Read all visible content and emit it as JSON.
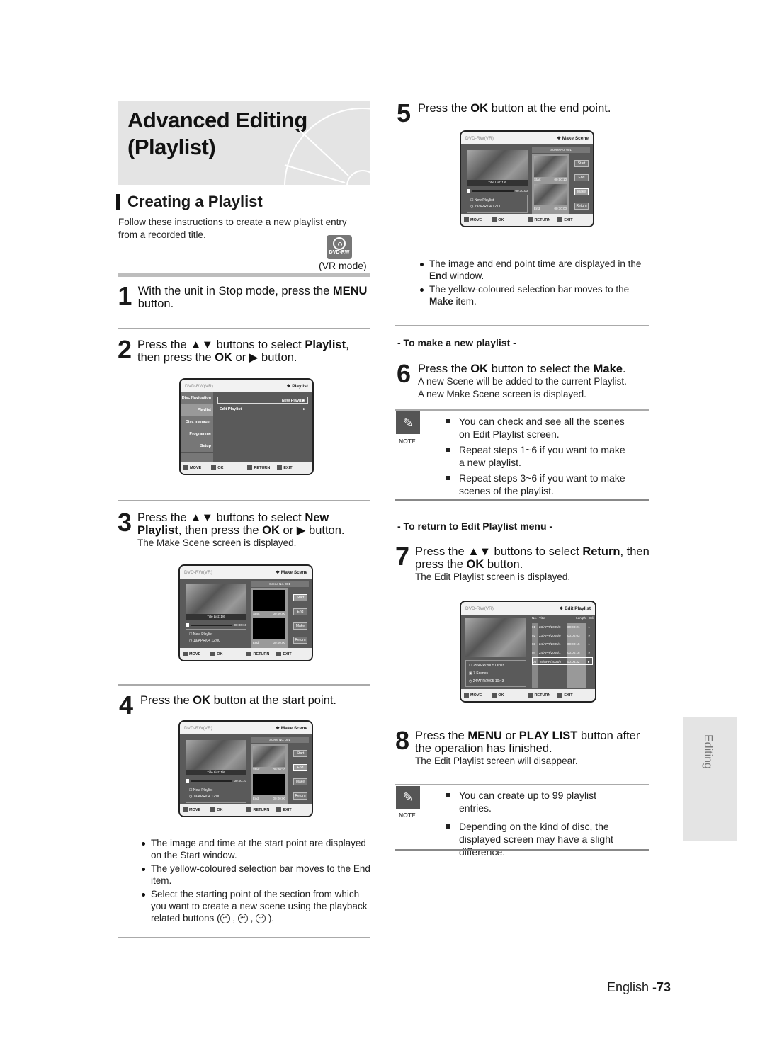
{
  "header": {
    "title_line1": "Advanced Editing",
    "title_line2": "(Playlist)"
  },
  "section": {
    "title": "Creating a Playlist",
    "intro": "Follow these instructions to create a new playlist entry from a recorded title.",
    "disc_badge": "DVD-RW",
    "mode": "(VR mode)"
  },
  "steps": [
    {
      "num": "1",
      "pre": "With the unit in Stop mode, press the ",
      "bold1": "MENU",
      "post": " button."
    },
    {
      "num": "2",
      "pre": "Press the ▲▼ buttons to select ",
      "bold1": "Playlist",
      "mid": ", then press the ",
      "bold2": "OK",
      "post": " or ▶ button."
    },
    {
      "num": "3",
      "pre": "Press the ▲▼ buttons to select ",
      "bold1": "New Playlist",
      "mid": ", then press the ",
      "bold2": "OK",
      "post": " or ▶ button.",
      "sub": "The Make Scene screen is displayed."
    },
    {
      "num": "4",
      "pre": "Press the ",
      "bold1": "OK",
      "post": " button at the start point."
    },
    {
      "num": "5",
      "pre": "Press the ",
      "bold1": "OK",
      "post": " button at the end point."
    },
    {
      "num": "6",
      "pre": "Press the ",
      "bold1": "OK",
      "mid": " button to select the ",
      "bold2": "Make",
      "post": ".",
      "sub1": "A new Scene will be added to the current Playlist.",
      "sub2": "A new Make Scene screen is displayed."
    },
    {
      "num": "7",
      "pre": "Press the ▲▼ buttons to select ",
      "bold1": "Return",
      "mid": ", then press the ",
      "bold2": "OK",
      "post": " button.",
      "sub": "The Edit Playlist screen is displayed."
    },
    {
      "num": "8",
      "pre": "Press the ",
      "bold1": "MENU",
      "mid": " or ",
      "bold2": "PLAY LIST",
      "post": " button after the operation has finished.",
      "sub": "The Edit Playlist screen will disappear."
    }
  ],
  "step4_bullets": [
    "The image and time at the start point are displayed on the Start window.",
    "The yellow-coloured selection bar moves to the End item.",
    "Select the starting point of the section from which you want to create a new scene using the playback related  buttons ("
  ],
  "step5_bullets": [
    {
      "bold": "End",
      "pre": "The image and end point time are displayed in the ",
      "post": " window."
    },
    {
      "bold": "Make",
      "pre": "The yellow-coloured selection bar moves to the ",
      "post": "  item."
    }
  ],
  "subheads": {
    "new_playlist": "- To make a new playlist -",
    "return_menu": "- To return to Edit Playlist menu -"
  },
  "note1": {
    "label": "NOTE",
    "items": [
      "You can check and see all the scenes on Edit Playlist screen.",
      "Repeat steps 1~6 if you want to make a new playlist.",
      "Repeat steps 3~6 if you want to make scenes of the playlist."
    ]
  },
  "note2": {
    "label": "NOTE",
    "items": [
      "You can create up to 99 playlist entries.",
      "Depending on the kind of disc, the displayed screen may have a slight difference."
    ]
  },
  "screens": {
    "common": {
      "disc": "DVD-RW(VR)",
      "move": "MOVE",
      "ok": "OK",
      "return": "RETURN",
      "exit": "EXIT"
    },
    "playlist_menu": {
      "title": "Playlist",
      "side": [
        "Disc Navigation",
        "Playlist",
        "Disc manager",
        "Programme",
        "Setup"
      ],
      "items": [
        "New Playlist",
        "Edit Playlist"
      ],
      "selected": "New Playlist"
    },
    "make_scene_a": {
      "title": "Make Scene",
      "scene_no": "Scene No. 001",
      "title_list": "Title List: 1/6",
      "progress_time": "00:00:10",
      "playlist_name": "New Playlist",
      "date": "19/APR/04 12:00",
      "start_label": "Start",
      "start_time": "00:00:00",
      "end_label": "End",
      "end_time": "00:00:00",
      "buttons": [
        "Start",
        "End",
        "Make",
        "Return"
      ],
      "selected": "Start"
    },
    "make_scene_b": {
      "title": "Make Scene",
      "scene_no": "Scene No. 001",
      "title_list": "Title List: 1/6",
      "progress_time": "00:00:10",
      "playlist_name": "New Playlist",
      "date": "19/APR/04 12:00",
      "start_label": "Start",
      "start_time": "00:00:10",
      "end_label": "End",
      "end_time": "00:00:00",
      "buttons": [
        "Start",
        "End",
        "Make",
        "Return"
      ],
      "selected": "End"
    },
    "make_scene_c": {
      "title": "Make Scene",
      "scene_no": "Scene No. 001",
      "title_list": "Title List: 1/6",
      "progress_time": "00:10:00",
      "playlist_name": "New Playlist",
      "date": "19/APR/04 12:00",
      "start_label": "Start",
      "start_time": "00:00:10",
      "end_label": "End",
      "end_time": "00:10:00",
      "buttons": [
        "Start",
        "End",
        "Make",
        "Return"
      ],
      "selected": "Make"
    },
    "edit_playlist": {
      "title": "Edit Playlist",
      "columns": [
        "No.",
        "Title",
        "Length",
        "Edit"
      ],
      "rows": [
        {
          "no": "01",
          "title": "23/APR/2005/0",
          "length": "00:00:21"
        },
        {
          "no": "02",
          "title": "23/APR/2005/0",
          "length": "00:00:03"
        },
        {
          "no": "03",
          "title": "24/APR/2005/1",
          "length": "00:00:15"
        },
        {
          "no": "04",
          "title": "24/APR/2005/1",
          "length": "00:00:16"
        },
        {
          "no": "05",
          "title": "25/APR/2005/2",
          "length": "00:06:32"
        }
      ],
      "selected_row": "05",
      "info_date": "25/APR/2005 06:03",
      "info_scenes": "7 Scenes",
      "info_modified": "24/APR/2005 10:43"
    }
  },
  "side_tab": "Editing",
  "footer": {
    "lang": "English -",
    "page": "73"
  }
}
